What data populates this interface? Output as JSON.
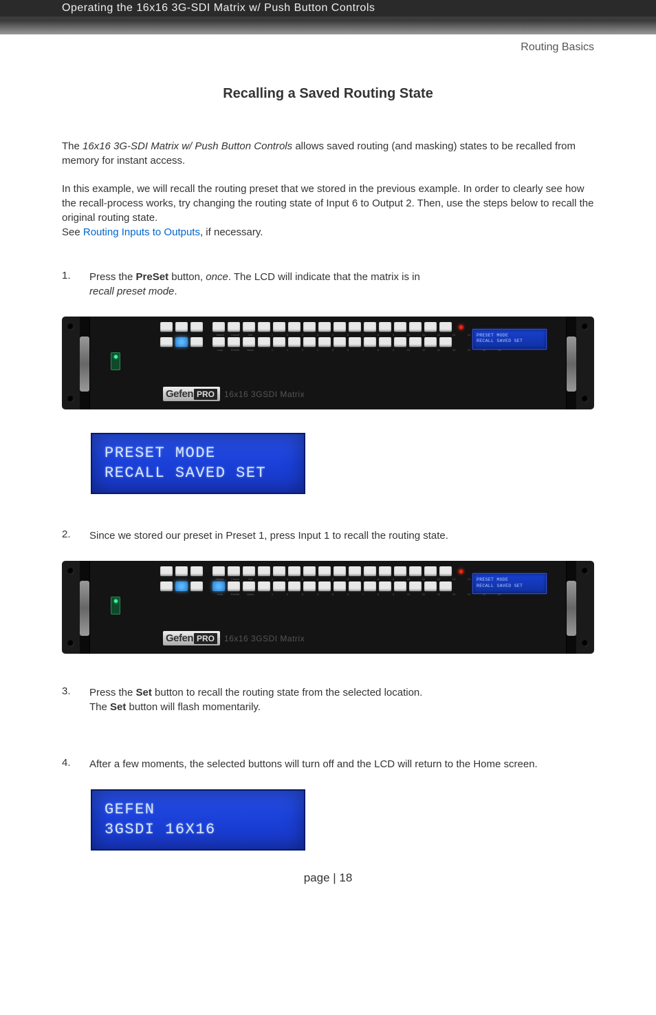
{
  "header": {
    "chapter": "Operating the 16x16 3G-SDI Matrix w/ Push Button Controls",
    "section": "Routing Basics"
  },
  "title": "Recalling a Saved Routing State",
  "intro": {
    "p1_a": "The ",
    "p1_product": "16x16 3G-SDI Matrix w/ Push Button Controls",
    "p1_b": " allows saved routing (and masking) states to be recalled from memory for instant access.",
    "p2_a": "In this example, we will recall the routing preset that we stored in the previous example.  In order to clearly see how the recall-process works, try changing the routing state of Input 6 to Output 2.  Then, use the steps below to recall the original routing state.",
    "p2_see": "See ",
    "p2_link": "Routing Inputs to Outputs",
    "p2_b": ", if necessary."
  },
  "steps": {
    "s1": {
      "num": "1.",
      "a": "Press the ",
      "btn": "PreSet",
      "b": " button, ",
      "once": "once",
      "c": ".  The LCD will indicate that the matrix is in",
      "mode": "recall preset mode",
      "d": "."
    },
    "s2": {
      "num": "2.",
      "text": "Since we stored our preset in Preset 1, press Input 1 to recall the routing state."
    },
    "s3": {
      "num": "3.",
      "a": "Press the ",
      "btn": "Set",
      "b": " button to recall the routing state from the selected location.",
      "c": "The ",
      "btn2": "Set",
      "d": " button will flash momentarily."
    },
    "s4": {
      "num": "4.",
      "text": "After a few moments, the selected buttons will turn off and the LCD will return to the Home screen."
    }
  },
  "device": {
    "top_labels": [
      "Select",
      "Cancel",
      "Set"
    ],
    "bot_labels": [
      "Lock",
      "PreSet",
      "Mask"
    ],
    "numbers": [
      "1",
      "2",
      "3",
      "4",
      "5",
      "6",
      "7",
      "8",
      "9",
      "10",
      "11",
      "12",
      "13",
      "14",
      "15",
      "16"
    ],
    "power": "Power",
    "ir": "IR",
    "brand_gefen": "Gefen",
    "brand_pro": "PRO",
    "model": "16x16 3GSDI Matrix",
    "lcd1_line1": "PRESET MODE",
    "lcd1_line2": "RECALL SAVED SET"
  },
  "lcd_big1": {
    "line1": "PRESET MODE",
    "line2": "RECALL SAVED SET"
  },
  "lcd_big2": {
    "line1": "GEFEN",
    "line2": "3GSDI 16X16"
  },
  "page": "page | 18"
}
